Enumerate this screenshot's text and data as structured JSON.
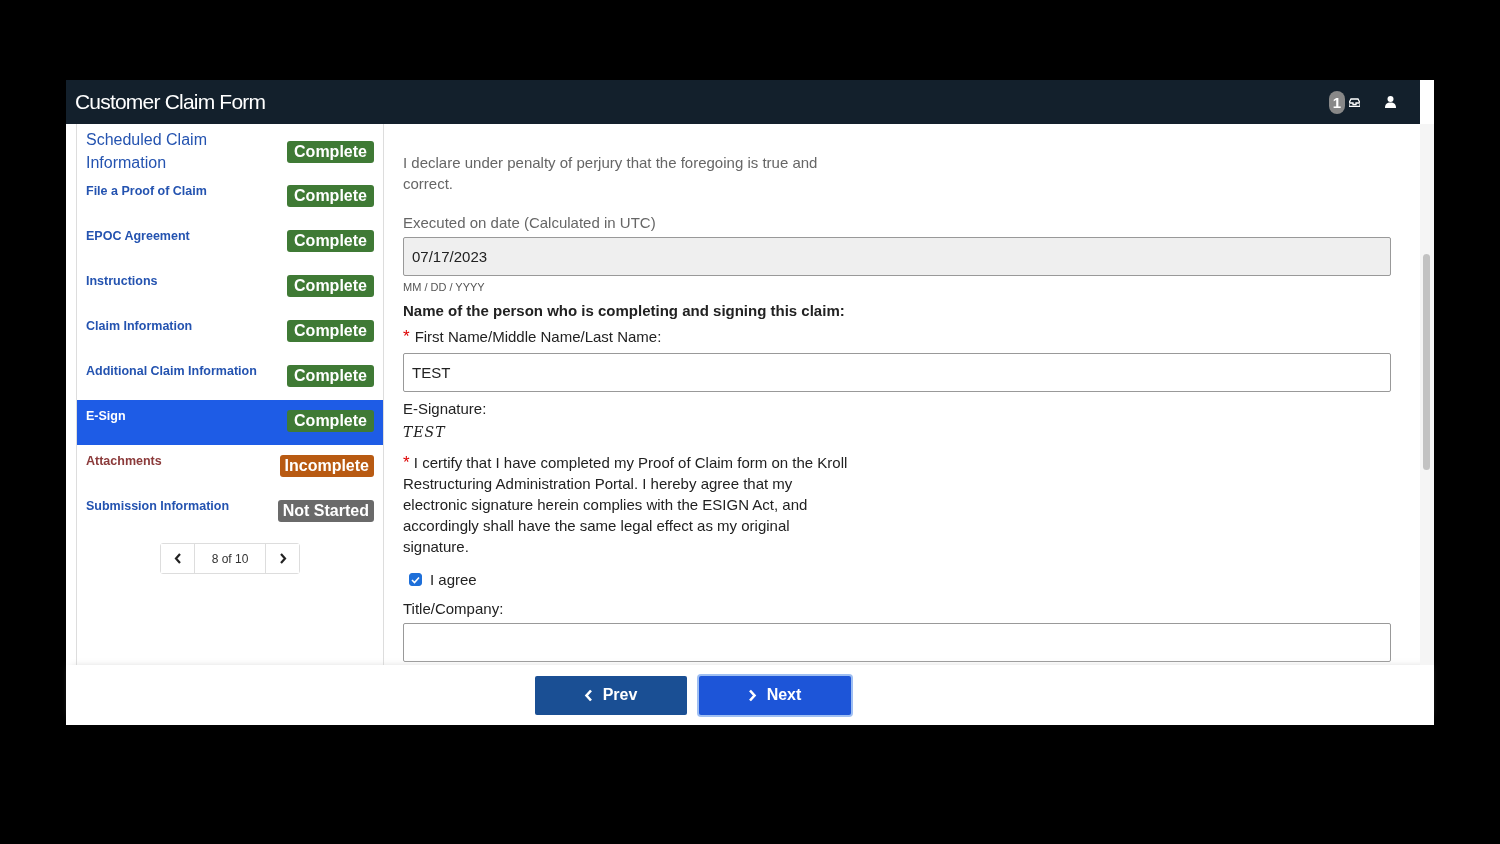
{
  "window": {
    "title": "Customer Claim Form"
  },
  "header": {
    "badge": "1"
  },
  "steps": [
    {
      "label": "Scheduled Claim Information",
      "kind": "heading",
      "status": "Complete",
      "color": "#3f7a35",
      "selected": false
    },
    {
      "label": "File a Proof of Claim",
      "kind": "link",
      "status": "Complete",
      "color": "#3f7a35",
      "selected": false
    },
    {
      "label": "EPOC Agreement",
      "kind": "link",
      "status": "Complete",
      "color": "#3f7a35",
      "selected": false
    },
    {
      "label": "Instructions",
      "kind": "link",
      "status": "Complete",
      "color": "#3f7a35",
      "selected": false
    },
    {
      "label": "Claim Information",
      "kind": "link",
      "status": "Complete",
      "color": "#3f7a35",
      "selected": false
    },
    {
      "label": "Additional Claim Information",
      "kind": "link",
      "status": "Complete",
      "color": "#3f7a35",
      "selected": false
    },
    {
      "label": "E-Sign",
      "kind": "link",
      "status": "Complete",
      "color": "#3f7a35",
      "selected": true
    },
    {
      "label": "Attachments",
      "kind": "alert",
      "status": "Incomplete",
      "color": "#b85a12",
      "selected": false
    },
    {
      "label": "Submission Information",
      "kind": "link",
      "status": "Not Started",
      "color": "#6a6a6a",
      "selected": false
    }
  ],
  "pager": {
    "text": "8 of 10"
  },
  "form": {
    "declaration": "I declare under penalty of perjury that the foregoing is true and correct.",
    "date_label": "Executed on date (Calculated in UTC)",
    "date_value": "07/17/2023",
    "date_hint": "MM / DD / YYYY",
    "signer_heading": "Name of the person who is completing and signing this claim:",
    "name_label": "First Name/Middle Name/Last Name:",
    "name_mark": "*",
    "name_value": "TEST",
    "esig_label": "E-Signature:",
    "esig_value": "TEST",
    "certify_mark": "*",
    "certify_text": "I certify that I have completed my Proof of Claim form on the Kroll Restructuring Administration Portal. I hereby agree that my electronic signature herein complies with the ESIGN Act, and accordingly shall have the same legal effect as my original signature.",
    "agree_label": "I agree",
    "agree_checked": true,
    "title_label": "Title/Company:"
  },
  "footer": {
    "prev": "Prev",
    "next": "Next"
  }
}
